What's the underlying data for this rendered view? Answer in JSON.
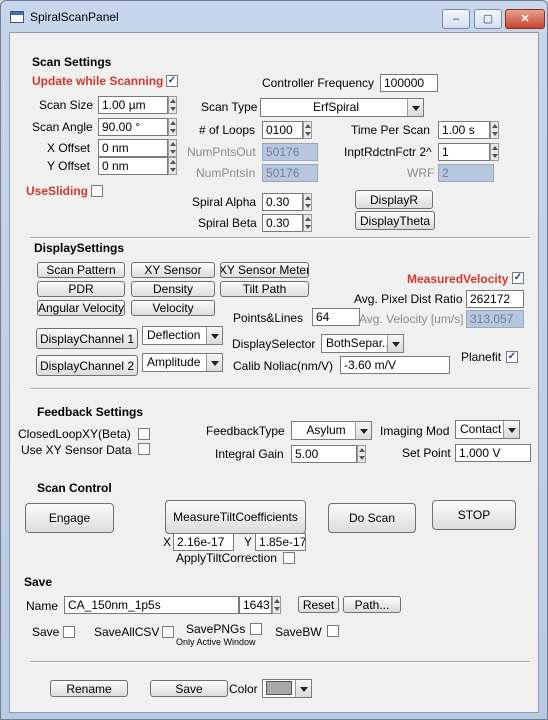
{
  "window": {
    "title": "SpiralScanPanel",
    "min": "–",
    "max": "▢",
    "close": "✕"
  },
  "scan_settings": {
    "header": "Scan Settings",
    "update_while_scanning": {
      "label": "Update while Scanning",
      "checked": true
    },
    "controller_frequency": {
      "label": "Controller Frequency",
      "value": "100000"
    },
    "scan_size": {
      "label": "Scan Size",
      "value": "1.00 µm"
    },
    "scan_angle": {
      "label": "Scan Angle",
      "value": "90.00 °"
    },
    "x_offset": {
      "label": "X Offset",
      "value": "0 nm"
    },
    "y_offset": {
      "label": "Y Offset",
      "value": "0 nm"
    },
    "scan_type": {
      "label": "Scan Type",
      "value": "ErfSpiral"
    },
    "num_loops": {
      "label": "# of Loops",
      "value": "0100"
    },
    "time_per_scan": {
      "label": "Time Per Scan",
      "value": "1.00 s"
    },
    "num_pnts_out": {
      "label": "NumPntsOut",
      "value": "50176"
    },
    "inpt_rdctn": {
      "label": "InptRdctnFctr 2^",
      "value": "1"
    },
    "num_pnts_in": {
      "label": "NumPntsIn",
      "value": "50176"
    },
    "wrf": {
      "label": "WRF",
      "value": "2"
    },
    "use_sliding": {
      "label": "UseSliding",
      "checked": false
    },
    "display_r": "DisplayR",
    "spiral_alpha": {
      "label": "Spiral Alpha",
      "value": "0.30"
    },
    "spiral_beta": {
      "label": "Spiral Beta",
      "value": "0.30"
    },
    "display_theta": "DisplayTheta"
  },
  "display_settings": {
    "header": "DisplaySettings",
    "buttons": [
      "Scan Pattern",
      "XY Sensor",
      "XY Sensor Meter",
      "PDR",
      "Density",
      "Tilt Path",
      "Angular Velocity",
      "Velocity"
    ],
    "measured_velocity": {
      "label": "MeasuredVelocity",
      "checked": true
    },
    "avg_pixel_dist": {
      "label": "Avg. Pixel Dist Ratio",
      "value": "262172"
    },
    "points_lines": {
      "label": "Points&Lines",
      "value": "64"
    },
    "avg_velocity": {
      "label": "Avg. Velocity [um/s]",
      "value": "313.057"
    },
    "channel1": {
      "label": "DisplayChannel 1",
      "value": "Deflection"
    },
    "channel2": {
      "label": "DisplayChannel 2",
      "value": "Amplitude"
    },
    "display_selector": {
      "label": "DisplaySelector",
      "value": "BothSepar..."
    },
    "calib_noliac": {
      "label": "Calib Noliac(nm/V)",
      "value": "-3.60 m/V"
    },
    "planefit": {
      "label": "Planefit",
      "checked": true
    }
  },
  "feedback": {
    "header": "Feedback Settings",
    "closed_loop": {
      "label": "ClosedLoopXY(Beta)",
      "checked": false
    },
    "use_xy_sensor": {
      "label": "Use XY Sensor Data",
      "checked": false
    },
    "feedback_type": {
      "label": "FeedbackType",
      "value": "Asylum"
    },
    "imaging_mode": {
      "label": "Imaging Mod",
      "value": "Contact"
    },
    "integral_gain": {
      "label": "Integral Gain",
      "value": "5.00"
    },
    "set_point": {
      "label": "Set Point",
      "value": "1.000 V"
    }
  },
  "scan_control": {
    "header": "Scan Control",
    "engage": "Engage",
    "measure_tilt": "MeasureTiltCoefficients",
    "do_scan": "Do Scan",
    "stop": "STOP",
    "x_label": "X",
    "x_value": "2.16e-17",
    "y_label": "Y",
    "y_value": "1.85e-17",
    "apply_tilt": {
      "label": "ApplyTiltCorrection",
      "checked": false
    }
  },
  "save": {
    "header": "Save",
    "name_label": "Name",
    "name_value": "CA_150nm_1p5s",
    "index": "1643",
    "reset": "Reset",
    "path": "Path...",
    "save_cb": "Save",
    "save_all_csv": "SaveAllCSV",
    "save_pngs": "SavePNGs",
    "only_active": "Only Active Window",
    "save_bw": "SaveBW"
  },
  "bottom": {
    "rename": "Rename",
    "save": "Save",
    "color_label": "Color",
    "color_value": "#a9a9a9"
  }
}
